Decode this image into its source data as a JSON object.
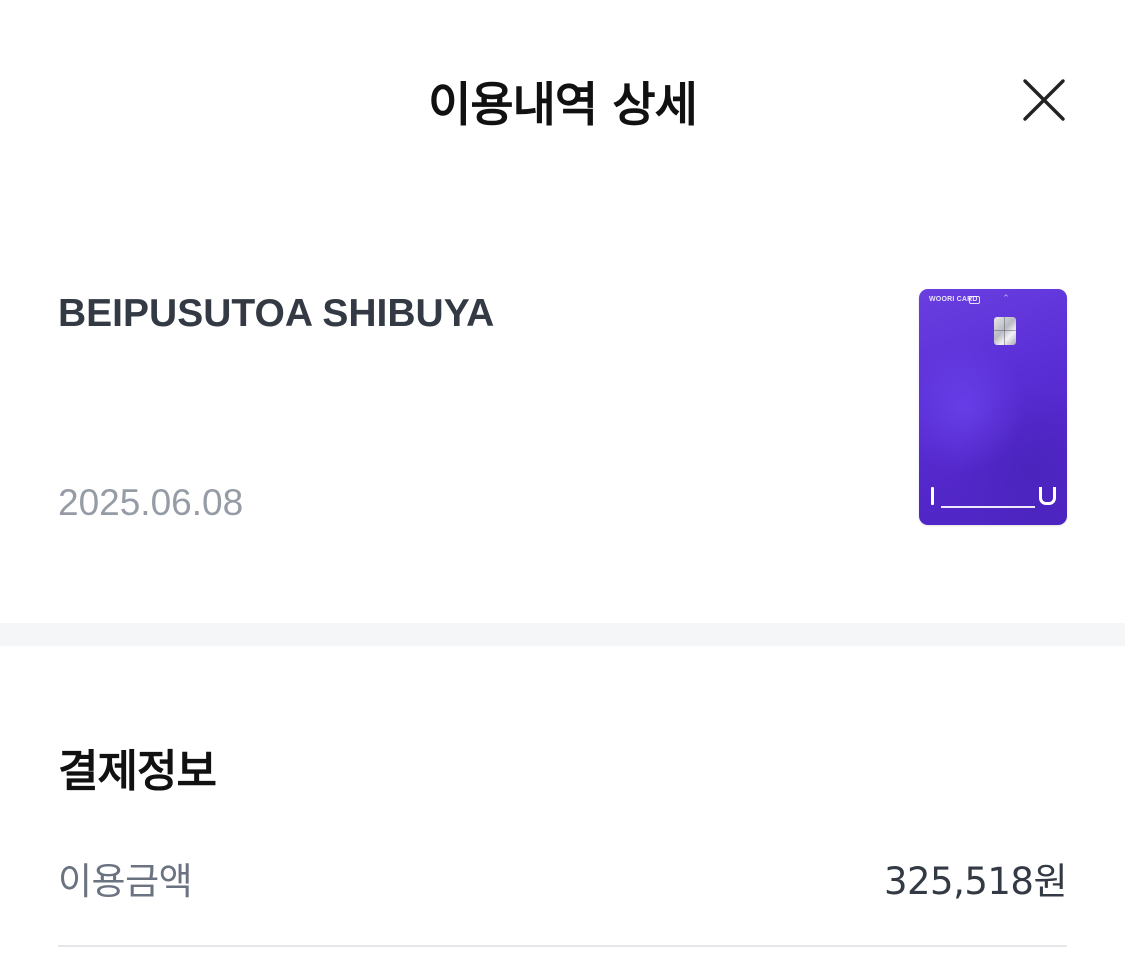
{
  "header": {
    "title": "이용내역 상세",
    "close_icon": "close-icon"
  },
  "transaction": {
    "merchant": "BEIPUSUTOA SHIBUYA",
    "date": "2025.06.08"
  },
  "card": {
    "brand": "WOORI CARD",
    "color": "#5a2fd6"
  },
  "payment_info": {
    "title": "결제정보",
    "rows": [
      {
        "label": "이용금액",
        "value": "325,518원"
      }
    ]
  }
}
